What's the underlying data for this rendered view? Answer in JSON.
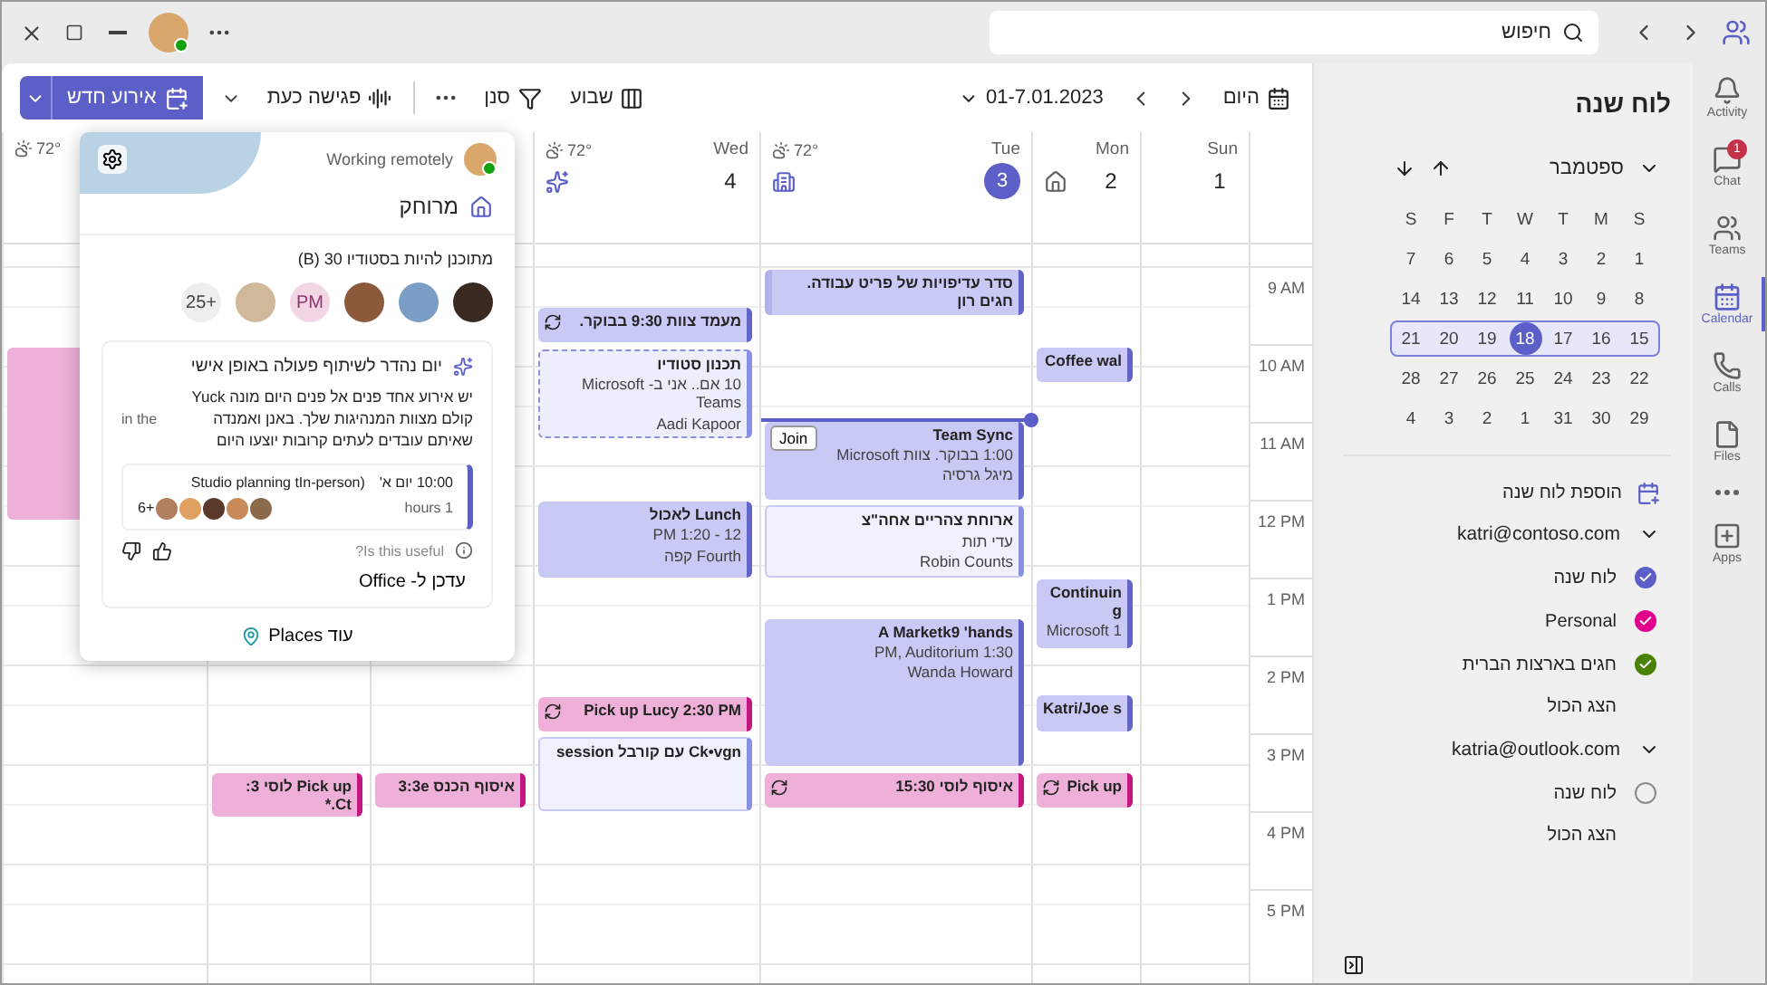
{
  "titlebar": {
    "search": {
      "placeholder": "חיפוש"
    }
  },
  "rail": [
    {
      "label": "Activity",
      "selected": false
    },
    {
      "label": "Chat",
      "selected": false,
      "badge": "1"
    },
    {
      "label": "Teams",
      "selected": false
    },
    {
      "label": "Calendar",
      "selected": true
    },
    {
      "label": "Calls",
      "selected": false
    },
    {
      "label": "Files",
      "selected": false
    },
    {
      "selected": false
    },
    {
      "label": "Apps",
      "selected": false
    }
  ],
  "sidebar": {
    "title": "לוח שנה",
    "month": "ספטמבר",
    "weekdays": [
      "S",
      "M",
      "T",
      "W",
      "T",
      "F",
      "S"
    ],
    "weeks": [
      {
        "selected": false,
        "days": [
          {
            "d": "1",
            "selected": false
          },
          {
            "d": "2",
            "selected": false
          },
          {
            "d": "3",
            "selected": false
          },
          {
            "d": "4",
            "selected": false
          },
          {
            "d": "5",
            "selected": false
          },
          {
            "d": "6",
            "selected": false
          },
          {
            "d": "7",
            "selected": false
          }
        ]
      },
      {
        "selected": false,
        "days": [
          {
            "d": "8",
            "selected": false
          },
          {
            "d": "9",
            "selected": false
          },
          {
            "d": "10",
            "selected": false
          },
          {
            "d": "11",
            "selected": false
          },
          {
            "d": "12",
            "selected": false
          },
          {
            "d": "13",
            "selected": false
          },
          {
            "d": "14",
            "selected": false
          }
        ]
      },
      {
        "selected": true,
        "days": [
          {
            "d": "15",
            "selected": false
          },
          {
            "d": "16",
            "selected": false
          },
          {
            "d": "17",
            "selected": false
          },
          {
            "d": "18",
            "selected": true
          },
          {
            "d": "19",
            "selected": false
          },
          {
            "d": "20",
            "selected": false
          },
          {
            "d": "21",
            "selected": false
          }
        ]
      },
      {
        "selected": false,
        "days": [
          {
            "d": "22",
            "selected": false
          },
          {
            "d": "23",
            "selected": false
          },
          {
            "d": "24",
            "selected": false
          },
          {
            "d": "25",
            "selected": false
          },
          {
            "d": "26",
            "selected": false
          },
          {
            "d": "27",
            "selected": false
          },
          {
            "d": "28",
            "selected": false
          }
        ]
      },
      {
        "selected": false,
        "days": [
          {
            "d": "29",
            "selected": false
          },
          {
            "d": "30",
            "selected": false
          },
          {
            "d": "31",
            "selected": false
          },
          {
            "d": "1",
            "selected": false
          },
          {
            "d": "2",
            "selected": false
          },
          {
            "d": "3",
            "selected": false
          },
          {
            "d": "4",
            "selected": false
          }
        ]
      }
    ],
    "add_calendar": "הוספת לוח שנה",
    "accounts": [
      {
        "name": "katri@contoso.com",
        "expanded": true,
        "calendars": [
          {
            "name": "לוח שנה",
            "checked": true,
            "color": "#5b5fc7"
          },
          {
            "name": "Personal",
            "checked": true,
            "color": "#e3008c"
          },
          {
            "name": "חגים בארצות הברית",
            "checked": true,
            "color": "#498205"
          }
        ],
        "show_all": "הצג הכול"
      },
      {
        "name": "katria@outlook.com",
        "expanded": true,
        "calendars": [
          {
            "name": "לוח שנה",
            "checked": false,
            "color": "#8a8a8a"
          }
        ],
        "show_all": "הצג הכול"
      }
    ]
  },
  "toolbar": {
    "today": "היום",
    "range": "01-7.01.2023",
    "view": "שבוע",
    "filter": "סנן",
    "meet_now": "פגישה כעת",
    "new_event": "אירוע חדש"
  },
  "days": [
    {
      "label": "Sun",
      "num": "1",
      "selected": false
    },
    {
      "label": "Mon",
      "num": "2",
      "selected": false,
      "kind": "home"
    },
    {
      "label": "Tue",
      "num": "3",
      "selected": true,
      "kind": "office",
      "weather": "72°"
    },
    {
      "label": "Wed",
      "num": "4",
      "selected": false,
      "kind": "new",
      "weather": "72°"
    },
    {
      "weather": "72°"
    }
  ],
  "hours": [
    "9 AM",
    "10 AM",
    "11 AM",
    "12 PM",
    "1 PM",
    "2 PM",
    "3 PM",
    "4 PM",
    "5 PM"
  ],
  "events": [
    {
      "kind": "hatched",
      "lines": [
        "סדר עדיפויות של פריט עבודה. חגים רון"
      ]
    },
    {
      "kind": "busy",
      "lines": [
        "Team Sync",
        "1:00 בבוקר. צוות Microsoft",
        "מיגל גרסיה"
      ],
      "join": "Join"
    },
    {
      "kind": "free",
      "lines": [
        "ארוחת צהריים אחה\"צ",
        "עדי תות",
        "Robin Counts"
      ]
    },
    {
      "kind": "busy",
      "lines": [
        "A Marketk9 'hands",
        "1:30 PM, Auditorium",
        "Wanda Howard"
      ]
    },
    {
      "kind": "personal",
      "recurring": true,
      "lines": [
        "איסוף לוסי 15:30"
      ]
    },
    {
      "kind": "busy",
      "lines": [
        "Coffee wal"
      ]
    },
    {
      "kind": "busy",
      "lines": [
        "Continuing",
        "Microsoft 1"
      ]
    },
    {
      "kind": "busy",
      "lines": [
        "Katri/Joe s"
      ]
    },
    {
      "kind": "personal",
      "recurring": true,
      "lines": [
        "Pick up"
      ]
    },
    {
      "kind": "busy",
      "recurring": true,
      "lines": [
        "מעמד צוות 9:30 בבוקר."
      ]
    },
    {
      "kind": "tentative",
      "lines": [
        "תכנון סטודיו",
        "10 אם.. אני ב- Microsoft Teams",
        "Aadi Kapoor"
      ]
    },
    {
      "kind": "busy",
      "lines": [
        "Lunch לאכול",
        "12 - 1:20 PM",
        "Fourth קפה"
      ]
    },
    {
      "kind": "personal",
      "recurring": true,
      "lines": [
        "Pick up Lucy 2:30 PM"
      ]
    },
    {
      "kind": "free",
      "lines": [
        "Ck•vgn עם קורבל  session"
      ]
    },
    {
      "kind": "personal",
      "lines": [
        "איסוף הכנס 3:3e"
      ]
    },
    {
      "kind": "personal",
      "lines": [
        "Pick up לוסי 3: Ct.*"
      ]
    },
    {
      "kind": "personal"
    }
  ],
  "popup": {
    "status": "Working remotely",
    "place": "מרוחק",
    "planned": "מתוכנן להיות בסטודיו 30 (B)",
    "people_more": "+25",
    "people_initials": "PM",
    "card": {
      "title": "יום נהדר לשיתוף פעולה באופן אישי",
      "body": "יש אירוע אחד פנים אל פנים היום מונה Yuck קולם מצוות המנהיגות שלך. באנן ואמנדה שאיתם עובדים לעתים קרובות יוצעו היום",
      "aside": "in the",
      "event_time": "10:00 יום א'",
      "event_title": "(Studio planning tIn-person",
      "event_duration": "1 hours",
      "event_more": "+6",
      "useful": "Is this useful?",
      "update": "עדכן ל- Office"
    },
    "more": "עוד Places"
  }
}
